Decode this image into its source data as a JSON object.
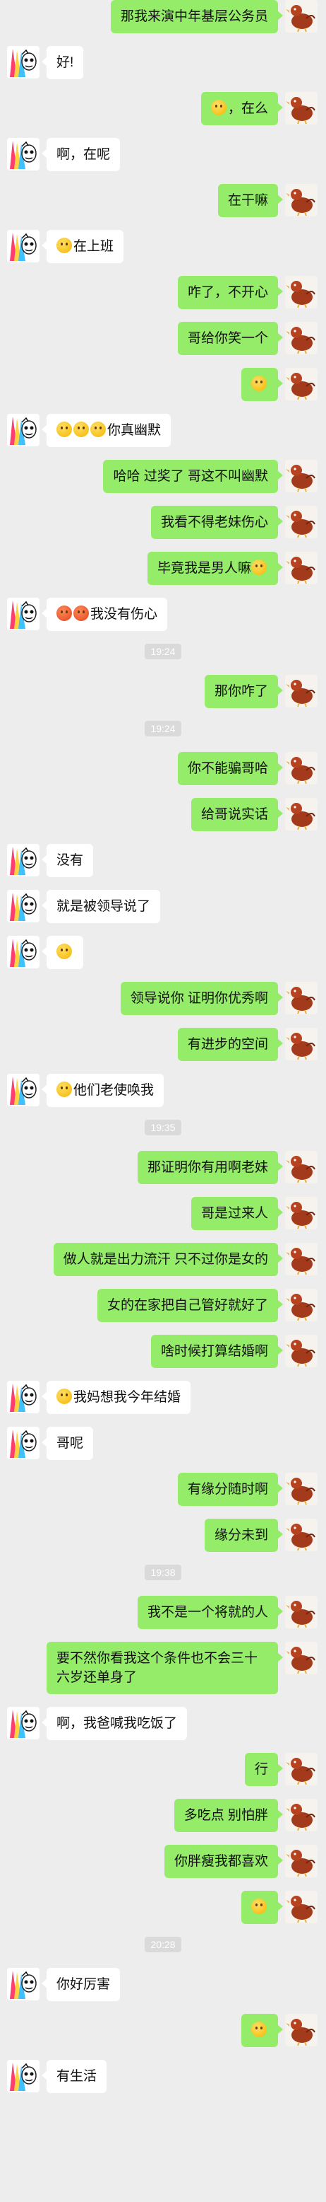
{
  "colors": {
    "background": "#ededed",
    "self_bubble": "#95ec69",
    "other_bubble": "#ffffff",
    "timestamp_bg": "#dadada"
  },
  "avatars": {
    "self": "duck-avatar",
    "other": "rainbow-character-avatar"
  },
  "messages": [
    {
      "type": "msg",
      "side": "right",
      "text": "那我来演中年基层公务员"
    },
    {
      "type": "msg",
      "side": "left",
      "text": "好!"
    },
    {
      "type": "msg",
      "side": "right",
      "emoji": [
        "smile"
      ],
      "text": "，在么"
    },
    {
      "type": "msg",
      "side": "left",
      "text": "啊，在呢"
    },
    {
      "type": "msg",
      "side": "right",
      "text": "在干嘛"
    },
    {
      "type": "msg",
      "side": "left",
      "emoji": [
        "smile"
      ],
      "text": "在上班"
    },
    {
      "type": "msg",
      "side": "right",
      "text": "咋了，不开心"
    },
    {
      "type": "msg",
      "side": "right",
      "text": "哥给你笑一个"
    },
    {
      "type": "msg",
      "side": "right",
      "emoji": [
        "laugh"
      ],
      "text": ""
    },
    {
      "type": "msg",
      "side": "left",
      "emoji": [
        "laugh",
        "laugh",
        "laugh"
      ],
      "text": "你真幽默"
    },
    {
      "type": "msg",
      "side": "right",
      "text": "哈哈 过奖了 哥这不叫幽默"
    },
    {
      "type": "msg",
      "side": "right",
      "text": "我看不得老妹伤心"
    },
    {
      "type": "msg",
      "side": "right",
      "text": "毕竟我是男人嘛",
      "emoji_after": [
        "smile"
      ]
    },
    {
      "type": "msg",
      "side": "left",
      "emoji_red": [
        "angry",
        "angry"
      ],
      "text": "我没有伤心"
    },
    {
      "type": "time",
      "text": "19:24"
    },
    {
      "type": "msg",
      "side": "right",
      "text": "那你咋了"
    },
    {
      "type": "time",
      "text": "19:24"
    },
    {
      "type": "msg",
      "side": "right",
      "text": "你不能骗哥哈"
    },
    {
      "type": "msg",
      "side": "right",
      "text": "给哥说实话"
    },
    {
      "type": "msg",
      "side": "left",
      "text": "没有"
    },
    {
      "type": "msg",
      "side": "left",
      "text": "就是被领导说了"
    },
    {
      "type": "msg",
      "side": "left",
      "emoji": [
        "sad"
      ],
      "text": ""
    },
    {
      "type": "msg",
      "side": "right",
      "text": "领导说你 证明你优秀啊"
    },
    {
      "type": "msg",
      "side": "right",
      "text": "有进步的空间"
    },
    {
      "type": "msg",
      "side": "left",
      "emoji": [
        "sad"
      ],
      "text": "他们老使唤我"
    },
    {
      "type": "time",
      "text": "19:35"
    },
    {
      "type": "msg",
      "side": "right",
      "text": "那证明你有用啊老妹"
    },
    {
      "type": "msg",
      "side": "right",
      "text": "哥是过来人"
    },
    {
      "type": "msg",
      "side": "right",
      "text": "做人就是出力流汗 只不过你是女的"
    },
    {
      "type": "msg",
      "side": "right",
      "text": "女的在家把自己管好就好了"
    },
    {
      "type": "msg",
      "side": "right",
      "text": "啥时候打算结婚啊"
    },
    {
      "type": "msg",
      "side": "left",
      "emoji": [
        "smile"
      ],
      "text": "我妈想我今年结婚"
    },
    {
      "type": "msg",
      "side": "left",
      "text": "哥呢"
    },
    {
      "type": "msg",
      "side": "right",
      "text": "有缘分随时啊"
    },
    {
      "type": "msg",
      "side": "right",
      "text": "缘分未到"
    },
    {
      "type": "time",
      "text": "19:38"
    },
    {
      "type": "msg",
      "side": "right",
      "text": "我不是一个将就的人"
    },
    {
      "type": "msg",
      "side": "right",
      "text": "要不然你看我这个条件也不会三十六岁还单身了"
    },
    {
      "type": "msg",
      "side": "left",
      "text": "啊，我爸喊我吃饭了"
    },
    {
      "type": "msg",
      "side": "right",
      "text": "行"
    },
    {
      "type": "msg",
      "side": "right",
      "text": "多吃点 别怕胖"
    },
    {
      "type": "msg",
      "side": "right",
      "text": "你胖瘦我都喜欢"
    },
    {
      "type": "msg",
      "side": "right",
      "emoji": [
        "laugh"
      ],
      "text": ""
    },
    {
      "type": "time",
      "text": "20:28"
    },
    {
      "type": "msg",
      "side": "left",
      "text": "你好厉害"
    },
    {
      "type": "msg",
      "side": "right",
      "emoji": [
        "smile"
      ],
      "text": ""
    },
    {
      "type": "msg",
      "side": "left",
      "text": "有生活"
    }
  ]
}
